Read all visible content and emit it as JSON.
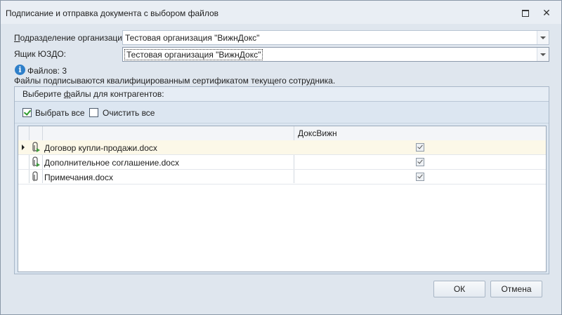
{
  "window": {
    "title": "Подписание и отправка документа с выбором файлов",
    "restore_icon": "restore-icon",
    "close_symbol": "✕"
  },
  "form": {
    "division_label_access": "П",
    "division_label_rest": "одразделение организации:",
    "division_value": "Тестовая организация \"ВижнДокс\"",
    "mailbox_label": "Ящик ЮЗДО:",
    "mailbox_value": "Тестовая организация \"ВижнДокс\""
  },
  "info": {
    "icon_glyph": "i",
    "files_count_text": "Файлов: 3",
    "note": "Файлы подписываются квалифицированным сертификатом текущего сотрудника."
  },
  "group": {
    "header_pre": "Выберите ",
    "header_access": "ф",
    "header_post": "айлы для контрагентов:"
  },
  "toolbar": {
    "select_all": "Выбрать все",
    "select_all_checked": true,
    "clear_all": "Очистить все",
    "clear_all_checked": false
  },
  "grid": {
    "column_header": "ДоксВижн",
    "rows": [
      {
        "name": "Договор купли-продажи.docx",
        "checked": true,
        "icon": "paperclip-signed-icon",
        "selected": true
      },
      {
        "name": "Дополнительное соглашение.docx",
        "checked": true,
        "icon": "paperclip-signed-icon",
        "selected": false
      },
      {
        "name": "Примечания.docx",
        "checked": true,
        "icon": "paperclip-icon",
        "selected": false
      }
    ]
  },
  "buttons": {
    "ok": "ОК",
    "cancel": "Отмена"
  }
}
